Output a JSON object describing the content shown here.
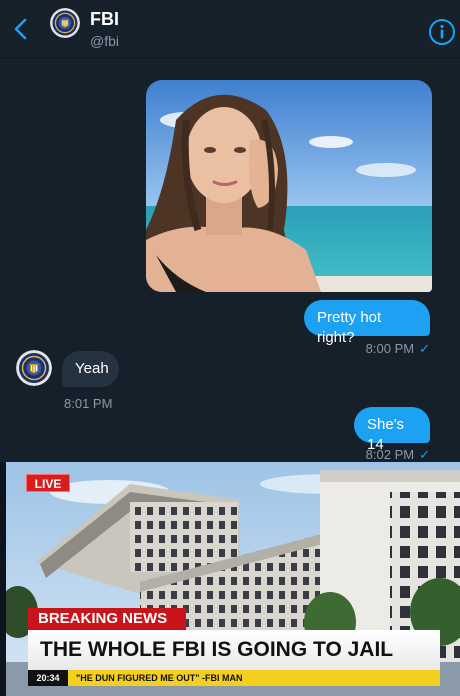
{
  "header": {
    "back_icon": "chevron-left-icon",
    "name": "FBI",
    "handle": "@fbi",
    "info_icon": "info-circle-icon"
  },
  "messages": [
    {
      "direction": "outgoing",
      "type": "image",
      "description_icon": "photo"
    },
    {
      "direction": "outgoing",
      "text": "Pretty hot right?",
      "time": "8:00 PM",
      "status": "✓"
    },
    {
      "direction": "incoming",
      "text": "Yeah",
      "time": "8:01 PM"
    },
    {
      "direction": "outgoing",
      "text": "She's 14",
      "time": "8:02 PM",
      "status": "✓"
    }
  ],
  "news": {
    "live": "LIVE",
    "breaking": "BREAKING NEWS",
    "headline": "THE WHOLE FBI IS GOING TO JAIL",
    "ticker_time": "20:34",
    "ticker_text": "\"HE DUN FIGURED ME OUT\" -FBI MAN"
  },
  "colors": {
    "background": "#15202b",
    "accent": "#1da1f2",
    "incoming_bubble": "#253341",
    "breaking_red": "#c9141a",
    "ticker_yellow": "#f5cf1f"
  }
}
